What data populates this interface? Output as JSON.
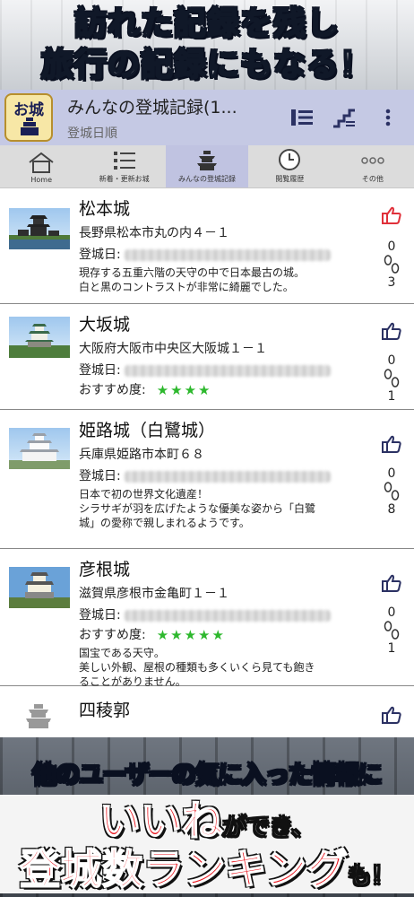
{
  "promo_top": {
    "line1": "訪れた記録を残し",
    "line2": "旅行の記録にもなる！"
  },
  "app": {
    "icon_text": "お城",
    "icon_caption": "いいね",
    "title": "みんなの登城記録(1...",
    "subtitle": "登城日順",
    "accent_color": "#c5c9e4"
  },
  "header_actions": [
    {
      "icon": "list-sort-icon"
    },
    {
      "icon": "stairs-sort-icon"
    },
    {
      "icon": "more-vert-icon"
    }
  ],
  "tabs": [
    {
      "label": "Home",
      "icon": "home-icon",
      "active": false
    },
    {
      "label": "新着・更新お城",
      "icon": "list-icon",
      "active": false
    },
    {
      "label": "みんなの登城記録",
      "icon": "castle-icon",
      "active": true
    },
    {
      "label": "閲覧履歴",
      "icon": "clock-icon",
      "active": false
    },
    {
      "label": "その他",
      "icon": "dots-icon",
      "active": false
    }
  ],
  "records": [
    {
      "name": "松本城",
      "address": "長野県松本市丸の内４－１",
      "date_label": "登城日:",
      "recommend_label": "",
      "stars": 0,
      "comment": [
        "現存する五重六階の天守の中で日本最古の城。",
        "白と黒のコントラストが非常に綺麗でした。"
      ],
      "likes": "0",
      "visits": "3",
      "liked": true
    },
    {
      "name": "大坂城",
      "address": "大阪府大阪市中央区大阪城１－１",
      "date_label": "登城日:",
      "recommend_label": "おすすめ度:",
      "stars": 4,
      "comment": [],
      "likes": "0",
      "visits": "1",
      "liked": false
    },
    {
      "name": "姫路城（白鷺城）",
      "address": "兵庫県姫路市本町６８",
      "date_label": "登城日:",
      "recommend_label": "",
      "stars": 0,
      "comment": [
        "日本で初の世界文化遺産！",
        "シラサギが羽を広げたような優美な姿から「白鷺",
        "城」の愛称で親しまれるようです。"
      ],
      "likes": "0",
      "visits": "8",
      "liked": false
    },
    {
      "name": "彦根城",
      "address": "滋賀県彦根市金亀町１－１",
      "date_label": "登城日:",
      "recommend_label": "おすすめ度:",
      "stars": 5,
      "comment": [
        "国宝である天守。",
        "美しい外観、屋根の種類も多くいくら見ても飽き",
        "ることがありません。"
      ],
      "likes": "0",
      "visits": "1",
      "liked": false
    },
    {
      "name": "四稜郭",
      "address": "",
      "date_label": "",
      "recommend_label": "",
      "stars": 0,
      "comment": [],
      "likes": "",
      "visits": "",
      "liked": false
    }
  ],
  "star_glyphs": {
    "four": "★★★★",
    "five": "★★★★★"
  },
  "promo_bottom": {
    "line1": "他のユーザーの気に入った情報に",
    "red1": "いいね",
    "small1": "ができ、",
    "red2": "登城数ランキング",
    "small2": "も！"
  },
  "colors": {
    "like_active": "#e0303a",
    "icon_dark": "#2b3163",
    "star": "#2db82d"
  }
}
